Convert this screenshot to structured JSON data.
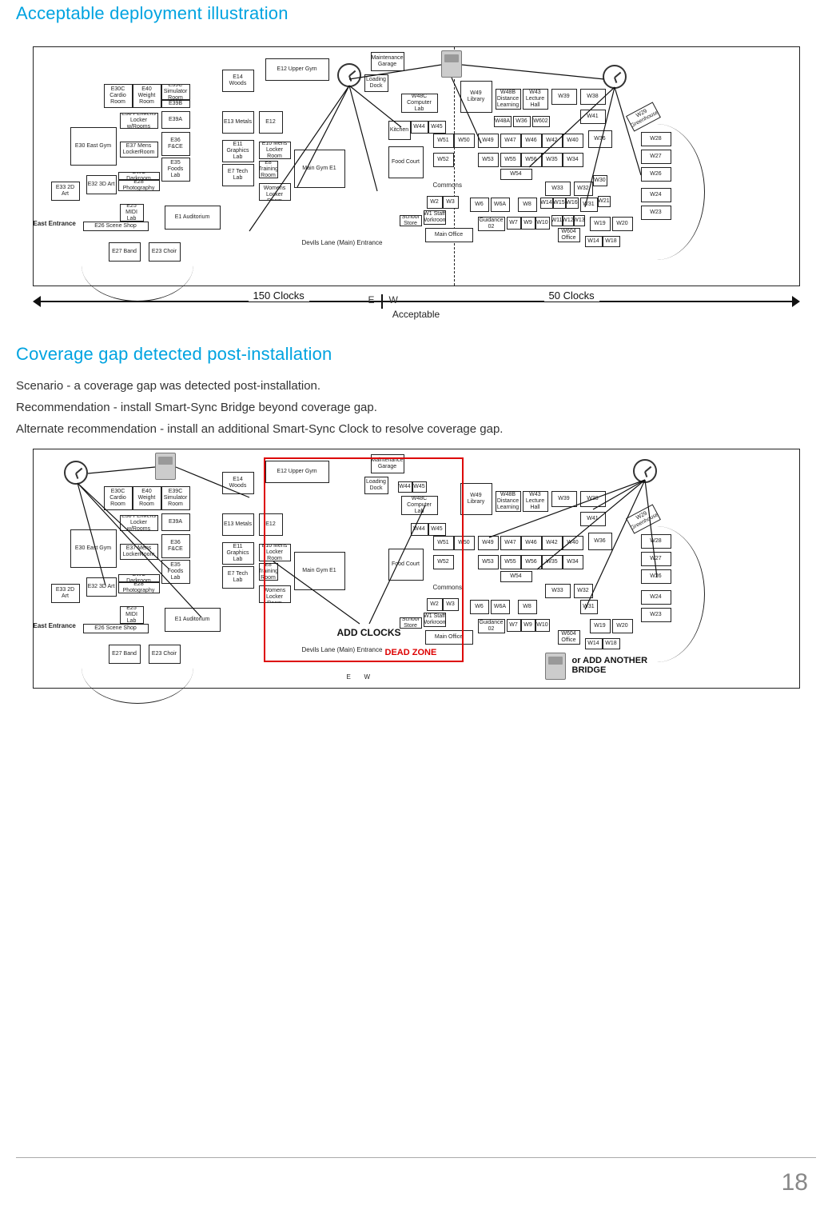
{
  "headings": {
    "acceptable": "Acceptable deployment illustration",
    "coverage_gap": "Coverage gap detected post-installation"
  },
  "paragraphs": {
    "scenario": "Scenario - a coverage gap was detected post-installation.",
    "recommendation": "Recommendation - install Smart-Sync Bridge beyond coverage gap.",
    "alternate": "Alternate recommendation - install an additional Smart-Sync Clock to resolve coverage gap."
  },
  "diagram1": {
    "east_entrance": "East Entrance",
    "clocks_left": "150 Clocks",
    "clocks_right": "50 Clocks",
    "divider_E": "E",
    "divider_W": "W",
    "caption": "Acceptable",
    "rooms": {
      "E30C": "E30C Cardio Room",
      "E40": "E40 Weight Room",
      "E39C": "E39C Simulator Room",
      "E39B": "E39B",
      "E39A": "E39A",
      "E38": "E38 PE/Mens Locker w/Rooms",
      "E37": "E37 Mens LockerRoom",
      "E36": "E36 F&CE",
      "E30": "E30 East Gym",
      "E35": "E35 Foods Lab",
      "GWC": "GWC Darkroom",
      "E33": "E33 2D Art",
      "E32": "E32 3D Art",
      "E28": "E28 Photography",
      "E25": "E25 MIDI Lab",
      "E26": "E26 Scene Shop",
      "E1": "E1 Auditorium",
      "E27": "E27 Band",
      "E23": "E23 Choir",
      "E14": "E14 Woods",
      "E13": "E13 Metals",
      "E11": "E11 Graphics Lab",
      "E7": "E7 Tech Lab",
      "E12U": "E12 Upper Gym",
      "E12": "E12",
      "E10": "E10 Mens Locker Room",
      "E8": "E8 Training Room",
      "E6": "E6 Womens Locker Room",
      "MainGym": "Main Gym E1",
      "DevilsLane": "Devils Lane (Main) Entrance",
      "MaintGarage": "Maintenance Garage",
      "LoadingDock": "Loading Dock",
      "W48C": "W48C Computer Lab",
      "Kitchen": "Kitchen",
      "W44": "W44",
      "W45": "W45",
      "W49": "W49 Library",
      "W48B": "W48B Distance Learning",
      "W43": "W43 Lecture Hall",
      "W39": "W39",
      "W38": "W38",
      "W48A": "W48A",
      "W36_s": "W36",
      "W602": "W602",
      "W41": "W41",
      "W51": "W51",
      "W50": "W50",
      "W49b": "W49",
      "W47": "W47",
      "W46": "W46",
      "W42": "W42",
      "W40": "W40",
      "W36": "W36",
      "Food": "Food Court",
      "W52": "W52",
      "W53": "W53",
      "W55": "W55",
      "W56": "W56",
      "W35": "W35",
      "W34": "W34",
      "W54": "W54",
      "Commons": "Commons",
      "W33": "W33",
      "W32": "W32",
      "W30": "W30",
      "W2": "W2",
      "W3": "W3",
      "W1": "W1 Staff Workroom",
      "School": "School Store",
      "W6": "W6",
      "W6A": "W6A",
      "W8": "W8",
      "W14": "W14",
      "W15": "W15",
      "W16": "W16",
      "W31": "W31",
      "W21": "W21",
      "MainOffice": "Main Office",
      "Guidance": "Guidance 02",
      "W7": "W7",
      "W9": "W9",
      "W10": "W10",
      "W11": "W11",
      "W12": "W12",
      "W13": "W13",
      "Office": "W604 Office",
      "W19": "W19",
      "W20": "W20",
      "W17": "W14",
      "W18": "W18",
      "W29": "W29 Greenhouse",
      "W28": "W28",
      "W27": "W27",
      "W26": "W26",
      "W24": "W24",
      "W23": "W23"
    }
  },
  "diagram2": {
    "east_entrance": "East Entrance",
    "add_clocks": "ADD CLOCKS",
    "dead_zone": "DEAD ZONE",
    "add_bridge": "or ADD ANOTHER BRIDGE",
    "divider_E": "E",
    "divider_W": "W"
  },
  "page_number": "18"
}
